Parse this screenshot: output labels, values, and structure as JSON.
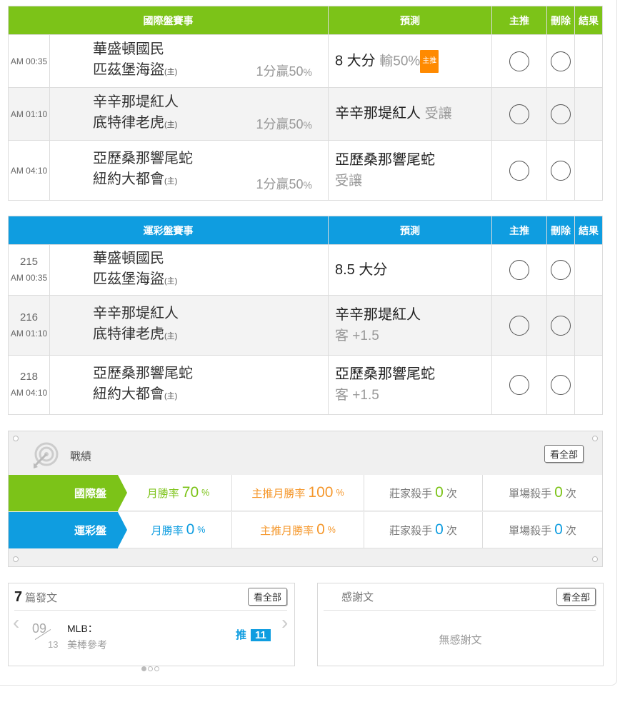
{
  "intl_table": {
    "headers": [
      "國際盤賽事",
      "預測",
      "主推",
      "刪除",
      "結果"
    ],
    "rows": [
      {
        "time": "AM 00:35",
        "team1": "華盛頓國民",
        "team2": "匹茲堡海盜",
        "home_mark": "(主)",
        "rate": "1分贏50",
        "rate_unit": "%",
        "pred": "8 大分",
        "pred_sub": "輸50%",
        "badge": "主推",
        "pred_line2": ""
      },
      {
        "time": "AM 01:10",
        "team1": "辛辛那堤紅人",
        "team2": "底特律老虎",
        "home_mark": "(主)",
        "rate": "1分贏50",
        "rate_unit": "%",
        "pred": "辛辛那堤紅人",
        "pred_sub": "受讓",
        "badge": "",
        "pred_line2": ""
      },
      {
        "time": "AM 04:10",
        "team1": "亞歷桑那響尾蛇",
        "team2": "紐約大都會",
        "home_mark": "(主)",
        "rate": "1分贏50",
        "rate_unit": "%",
        "pred": "亞歷桑那響尾蛇",
        "pred_sub": "",
        "badge": "",
        "pred_line2": "受讓"
      }
    ]
  },
  "sport_table": {
    "headers": [
      "運彩盤賽事",
      "預測",
      "主推",
      "刪除",
      "結果"
    ],
    "rows": [
      {
        "num": "215",
        "time": "AM 00:35",
        "team1": "華盛頓國民",
        "team2": "匹茲堡海盜",
        "home_mark": "(主)",
        "pred": "8.5 大分",
        "pred_line2": ""
      },
      {
        "num": "216",
        "time": "AM 01:10",
        "team1": "辛辛那堤紅人",
        "team2": "底特律老虎",
        "home_mark": "(主)",
        "pred": "辛辛那堤紅人",
        "pred_line2": "客 +1.5"
      },
      {
        "num": "218",
        "time": "AM 04:10",
        "team1": "亞歷桑那響尾蛇",
        "team2": "紐約大都會",
        "home_mark": "(主)",
        "pred": "亞歷桑那響尾蛇",
        "pred_line2": "客 +1.5"
      }
    ]
  },
  "record": {
    "title": "戰績",
    "view_all": "看全部",
    "rows": [
      {
        "tag": "國際盤",
        "month_label": "月勝率",
        "month_val": "70",
        "main_label": "主推月勝率",
        "main_val": "100",
        "pct": "%",
        "dealer_label": "莊家殺手",
        "dealer_val": "0",
        "single_label": "單場殺手",
        "single_val": "0",
        "times": "次"
      },
      {
        "tag": "運彩盤",
        "month_label": "月勝率",
        "month_val": "0",
        "main_label": "主推月勝率",
        "main_val": "0",
        "pct": "%",
        "dealer_label": "莊家殺手",
        "dealer_val": "0",
        "single_label": "單場殺手",
        "single_val": "0",
        "times": "次"
      }
    ]
  },
  "posts": {
    "count": "7",
    "label": "篇發文",
    "view_all": "看全部",
    "item": {
      "month": "09",
      "day": "13",
      "title": "MLB：",
      "subtitle": "美棒參考",
      "push_label": "推",
      "push_count": "11"
    }
  },
  "thanks": {
    "label": "感謝文",
    "view_all": "看全部",
    "empty": "無感謝文"
  },
  "colors": {
    "green": "#7cc318",
    "blue": "#0f9de0",
    "orange": "#f5982d"
  }
}
